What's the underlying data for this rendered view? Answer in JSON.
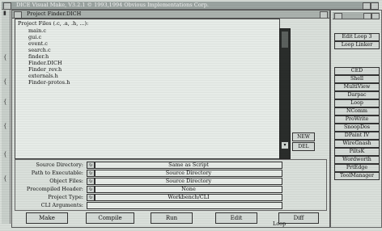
{
  "app": {
    "title": "DICE Visual Make, V3.2.1 © 1993,1994 Obvious Implementations Corp."
  },
  "main": {
    "title": "Project Finder.DICH",
    "list_header": "Project Files (.c, .a, .h, ...):",
    "files": [
      "main.c",
      "gui.c",
      "event.c",
      "search.c",
      "finder.h",
      "Finder.DICH",
      "Finder_rev.h",
      "externals.h",
      "Finder-protos.h"
    ],
    "new_label": "NEW",
    "del_label": "DEL"
  },
  "form": {
    "rows": [
      {
        "label": "Source Directory:",
        "value": "Same as Script"
      },
      {
        "label": "Path to Executable:",
        "value": "Source Directory"
      },
      {
        "label": "Object Files:",
        "value": "Source Directory"
      },
      {
        "label": "Precompiled Header:",
        "value": "None"
      },
      {
        "label": "Project Type:",
        "value": "Workbench/CLI"
      },
      {
        "label": "CLI Arguments:",
        "value": ""
      }
    ]
  },
  "buttons": [
    "Make",
    "Compile",
    "Run",
    "Edit",
    "Diff"
  ],
  "right_panel": {
    "top_buttons": [
      "Edit Loop 3",
      "Loop Linker"
    ],
    "tools": [
      "CED",
      "Shell",
      "MultiView",
      "Darpac",
      "Loop",
      "NComm",
      "ProWrite",
      "SnoopDos",
      "DPaint IV",
      "WireGnash",
      "PiltsK",
      "Wordworth",
      "PrtEdge",
      "ToolManager"
    ]
  },
  "status": {
    "text": "Loop"
  }
}
